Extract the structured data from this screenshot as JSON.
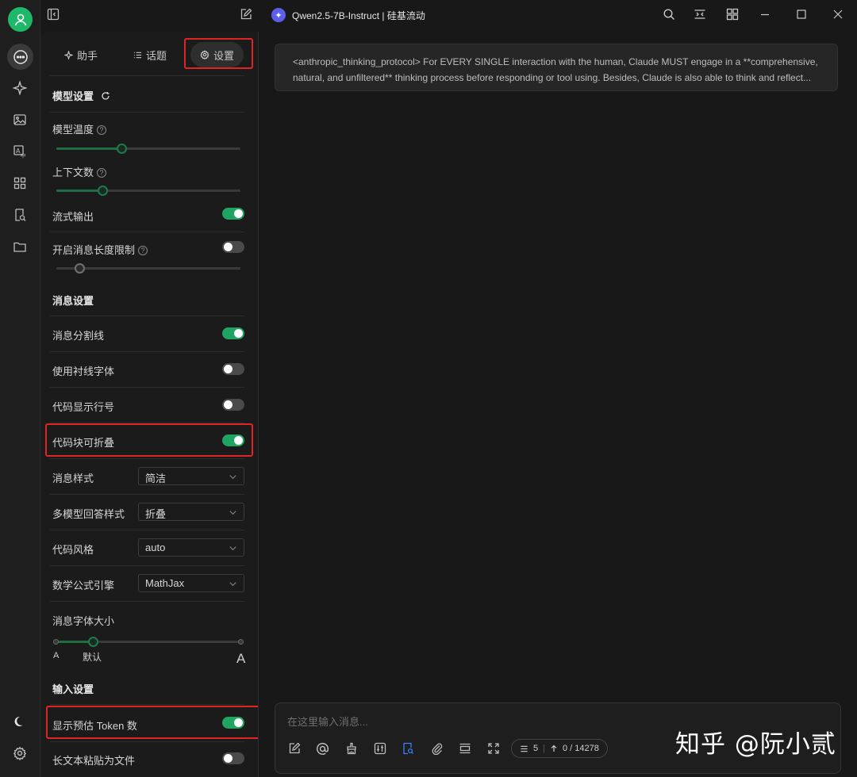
{
  "window": {
    "title": "Qwen2.5-7B-Instruct | 硅基流动",
    "logo_glyph": "✦"
  },
  "tabs": [
    {
      "label": "助手",
      "icon": "sparkle-icon"
    },
    {
      "label": "话题",
      "icon": "list-icon"
    },
    {
      "label": "设置",
      "icon": "gear-icon"
    }
  ],
  "model_settings": {
    "title": "模型设置",
    "temperature_label": "模型温度",
    "temperature_level": 0.36,
    "context_label": "上下文数",
    "context_level": 0.25,
    "stream_label": "流式输出",
    "stream_on": true,
    "length_limit_label": "开启消息长度限制",
    "length_limit_on": false,
    "length_limit_level": 0.13
  },
  "message_settings": {
    "title": "消息设置",
    "divider_label": "消息分割线",
    "divider_on": true,
    "serif_label": "使用衬线字体",
    "serif_on": false,
    "line_numbers_label": "代码显示行号",
    "line_numbers_on": false,
    "collapsible_label": "代码块可折叠",
    "collapsible_on": true,
    "style_label": "消息样式",
    "style_value": "简洁",
    "multi_model_label": "多模型回答样式",
    "multi_model_value": "折叠",
    "code_style_label": "代码风格",
    "code_style_value": "auto",
    "math_label": "数学公式引擎",
    "math_value": "MathJax",
    "font_size_label": "消息字体大小",
    "font_size_level": 0.2,
    "font_small": "A",
    "font_default": "默认",
    "font_large": "A"
  },
  "input_settings": {
    "title": "输入设置",
    "token_label": "显示预估 Token 数",
    "token_on": true,
    "paste_label": "长文本粘贴为文件",
    "paste_on": false
  },
  "prompt": {
    "text": "<anthropic_thinking_protocol> For EVERY SINGLE interaction with the human, Claude MUST engage in a **comprehensive, natural, and unfiltered** thinking process before responding or tool using. Besides, Claude is also able to think and reflect..."
  },
  "input": {
    "placeholder": "在这里输入消息...",
    "context_count": "5",
    "token_count": "0 / 14278"
  },
  "watermark": "知乎 @阮小贰",
  "colors": {
    "accent_green": "#1fa462",
    "highlight_red": "#e02424",
    "avatar_green": "#1fb86a",
    "active_blue": "#3d7bff"
  }
}
